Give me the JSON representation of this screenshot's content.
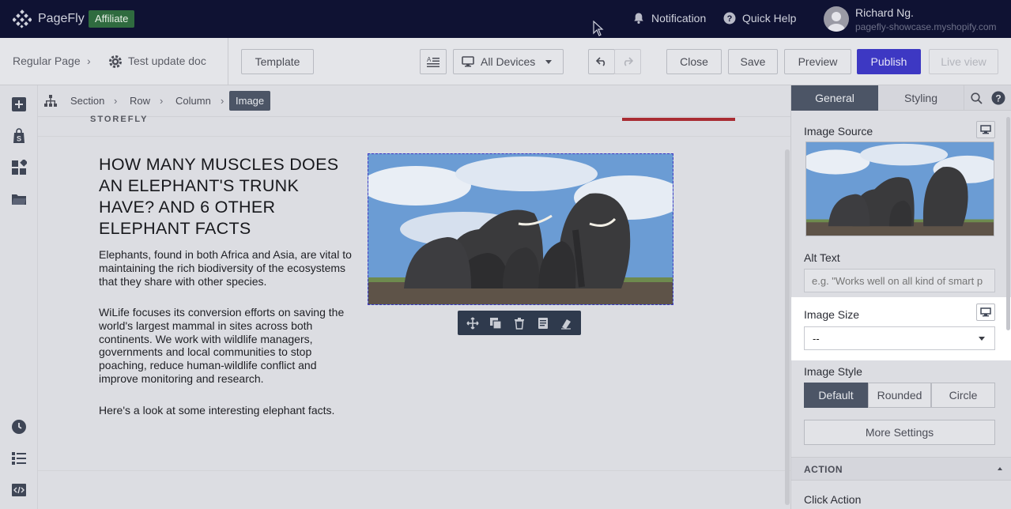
{
  "topbar": {
    "brand": "PageFly",
    "badge": "Affiliate",
    "notification_label": "Notification",
    "quick_help_label": "Quick Help",
    "user_name": "Richard Ng.",
    "user_shop": "pagefly-showcase.myshopify.com"
  },
  "toolbar": {
    "page_type": "Regular Page",
    "page_name": "Test update doc",
    "template_label": "Template",
    "devices_label": "All Devices",
    "close_label": "Close",
    "save_label": "Save",
    "preview_label": "Preview",
    "publish_label": "Publish",
    "live_view_label": "Live view"
  },
  "breadcrumb": {
    "items": [
      "Section",
      "Row",
      "Column"
    ],
    "active": "Image"
  },
  "canvas": {
    "store_name": "STOREFLY",
    "headline": "HOW MANY MUSCLES DOES AN ELEPHANT'S TRUNK HAVE? AND 6 OTHER ELEPHANT FACTS",
    "paragraphs": [
      "Elephants, found in both Africa and Asia, are vital to maintaining the rich biodiversity of the ecosystems that they share with other species.",
      "WiLife focuses its conversion efforts on saving the world's largest mammal in sites across both continents. We work with wildlife managers, governments and local communities to stop poaching, reduce human-wildlife conflict and improve monitoring and research.",
      "Here's a look at some interesting elephant facts."
    ]
  },
  "panel": {
    "tab_general": "General",
    "tab_styling": "Styling",
    "image_source_label": "Image Source",
    "alt_text_label": "Alt Text",
    "alt_text_placeholder": "e.g. \"Works well on all kind of smart p",
    "image_size_label": "Image Size",
    "image_size_value": "--",
    "image_style_label": "Image Style",
    "style_options": [
      "Default",
      "Rounded",
      "Circle"
    ],
    "style_selected": "Default",
    "more_settings_label": "More Settings",
    "action_section": "ACTION",
    "click_action_label": "Click Action"
  },
  "colors": {
    "topbar_bg": "#0f1233",
    "publish": "#3d38c3",
    "affiliate_badge": "#2f6b3f",
    "active_tab": "#4c5566"
  },
  "icons": {
    "sidebar": [
      "add-icon",
      "shopify-bag-icon",
      "elements-grid-icon",
      "folder-icon",
      "history-icon",
      "outline-list-icon",
      "code-icon"
    ]
  }
}
